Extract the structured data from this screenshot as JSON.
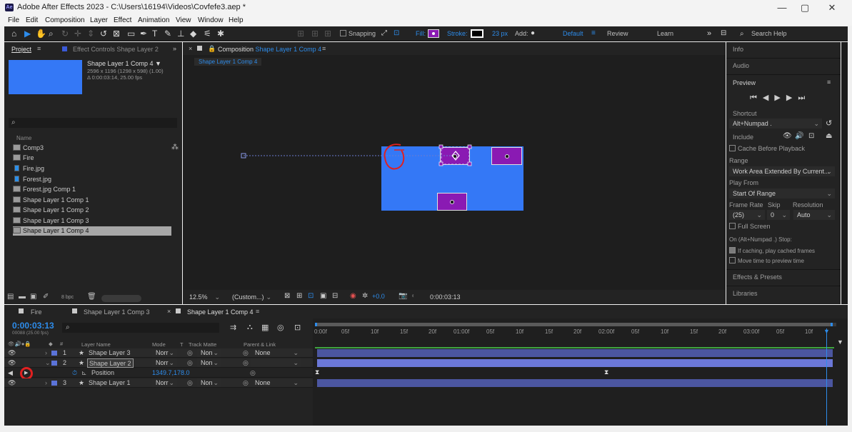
{
  "window": {
    "logo": "Ae",
    "title": "Adobe After Effects 2023 - C:\\Users\\16194\\Videos\\Covfefe3.aep *",
    "minimize": "—",
    "maximize": "▢",
    "close": "✕"
  },
  "menu": [
    "File",
    "Edit",
    "Composition",
    "Layer",
    "Effect",
    "Animation",
    "View",
    "Window",
    "Help"
  ],
  "toolbar": {
    "snapping": "Snapping",
    "fill": "Fill:",
    "stroke": "Stroke:",
    "stroke_width": "23 px",
    "add": "Add:",
    "workspaces": [
      "Default",
      "Review",
      "Learn"
    ],
    "more": "»",
    "search": "Search Help"
  },
  "project": {
    "tab_project": "Project",
    "tab_menu": "≡",
    "tab_effect_controls": "Effect Controls Shape Layer 2",
    "more": "»",
    "comp_name": "Shape Layer 1 Comp 4 ▼",
    "comp_size": "2596 x 1196  (1298 x 598) (1.00)",
    "comp_duration": "Δ 0:00:03:14, 25.00 fps",
    "search_icon": "⌕",
    "col_name": "Name",
    "items": [
      {
        "name": "Comp3",
        "type": "comp"
      },
      {
        "name": "Fire",
        "type": "comp"
      },
      {
        "name": "Fire.jpg",
        "type": "file"
      },
      {
        "name": "Forest.jpg",
        "type": "file"
      },
      {
        "name": "Forest.jpg Comp 1",
        "type": "comp"
      },
      {
        "name": "Shape Layer 1 Comp 1",
        "type": "comp"
      },
      {
        "name": "Shape Layer 1 Comp 2",
        "type": "comp"
      },
      {
        "name": "Shape Layer 1 Comp 3",
        "type": "comp"
      },
      {
        "name": "Shape Layer 1 Comp 4",
        "type": "comp",
        "selected": true
      }
    ],
    "bpc": "8 bpc"
  },
  "composition": {
    "tab_label": "Composition",
    "tab_comp": "Shape Layer 1 Comp 4",
    "tab_menu": "≡",
    "breadcrumb": "Shape Layer 1 Comp 4",
    "zoom": "12.5%",
    "resolution": "(Custom...)",
    "exposure": "+0.0",
    "timecode": "0:00:03:13",
    "bg_color": "#3478f6",
    "shape_color": "#8a1ab3"
  },
  "right_panel": {
    "info": "Info",
    "audio": "Audio",
    "preview": "Preview",
    "preview_menu": "≡",
    "shortcut_label": "Shortcut",
    "shortcut_value": "Alt+Numpad .",
    "include_label": "Include",
    "cache_before": "Cache Before Playback",
    "range_label": "Range",
    "range_value": "Work Area Extended By Current...",
    "play_from_label": "Play From",
    "play_from_value": "Start Of Range",
    "frame_rate_label": "Frame Rate",
    "skip_label": "Skip",
    "resolution_label": "Resolution",
    "frame_rate_value": "(25)",
    "skip_value": "0",
    "resolution_value": "Auto",
    "full_screen": "Full Screen",
    "stop_label": "On (Alt+Numpad .) Stop:",
    "if_caching": "If caching, play cached frames",
    "move_time": "Move time to preview time",
    "effects_presets": "Effects & Presets",
    "libraries": "Libraries"
  },
  "timeline": {
    "tabs": [
      "Fire",
      "Shape Layer 1 Comp 3",
      "Shape Layer 1 Comp 4"
    ],
    "tab_close": "×",
    "tab_menu": "≡",
    "timecode": "0:00:03:13",
    "timecode_sub": "00088 (25.00 fps)",
    "col_layer_name": "Layer Name",
    "col_mode": "Mode",
    "col_t": "T",
    "col_track_matte": "Track Matte",
    "col_parent": "Parent & Link",
    "layers": [
      {
        "num": "1",
        "name": "Shape Layer 3",
        "mode": "Norr",
        "matte": "Non",
        "parent": "None"
      },
      {
        "num": "2",
        "name": "Shape Layer 2",
        "mode": "Norr",
        "matte": "Non",
        "parent": ""
      },
      {
        "num": "3",
        "name": "Shape Layer 1",
        "mode": "Norr",
        "matte": "Non",
        "parent": "None"
      }
    ],
    "position_label": "Position",
    "position_value": "1349.7,178.0",
    "ruler": [
      "0:00f",
      "05f",
      "10f",
      "15f",
      "20f",
      "01:00f",
      "05f",
      "10f",
      "15f",
      "20f",
      "02:00f",
      "05f",
      "10f",
      "15f",
      "20f",
      "03:00f",
      "05f",
      "10f"
    ]
  }
}
